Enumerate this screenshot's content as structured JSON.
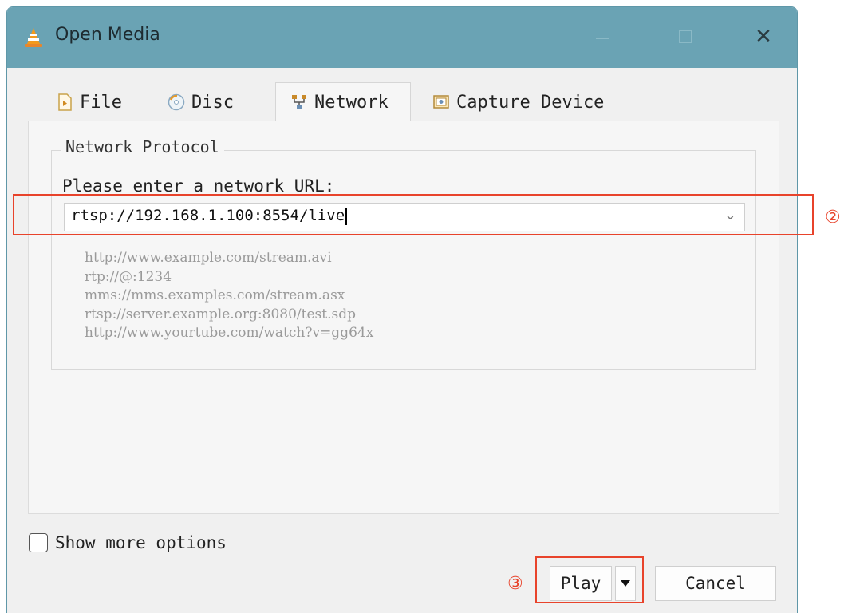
{
  "window": {
    "title": "Open Media",
    "close_glyph": "✕"
  },
  "tabs": [
    {
      "label": "File",
      "icon": "file-icon"
    },
    {
      "label": "Disc",
      "icon": "disc-icon"
    },
    {
      "label": "Network",
      "icon": "network-icon",
      "active": true
    },
    {
      "label": "Capture Device",
      "icon": "capture-device-icon"
    }
  ],
  "network": {
    "group_title": "Network Protocol",
    "url_label": "Please enter a network URL:",
    "url_value": "rtsp://192.168.1.100:8554/live",
    "examples": [
      "http://www.example.com/stream.avi",
      "rtp://@:1234",
      "mms://mms.examples.com/stream.asx",
      "rtsp://server.example.org:8080/test.sdp",
      "http://www.yourtube.com/watch?v=gg64x"
    ]
  },
  "options": {
    "show_more_label": "Show more options",
    "show_more_checked": false
  },
  "buttons": {
    "play": "Play",
    "cancel": "Cancel"
  },
  "annotations": {
    "url_marker": "②",
    "play_marker": "③",
    "color": "#e8432b"
  },
  "colors": {
    "titlebar": "#6aa3b4",
    "accent_annotation": "#e8432b"
  }
}
